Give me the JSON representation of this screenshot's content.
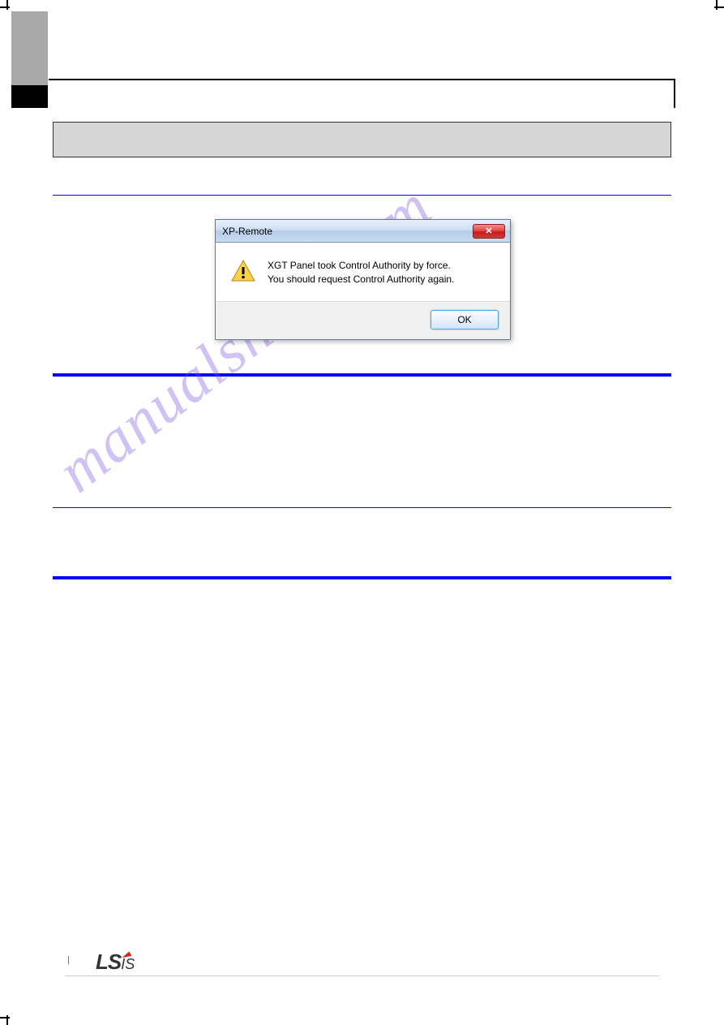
{
  "dialog": {
    "title": "XP-Remote",
    "message_line1": "XGT Panel took Control Authority by force.",
    "message_line2": "You should request Control Authority again.",
    "ok_label": "OK",
    "close_label": "✕"
  },
  "watermark": "manualshive.com",
  "page_number": "|",
  "logo": {
    "ls": "LS",
    "is": "IS"
  }
}
